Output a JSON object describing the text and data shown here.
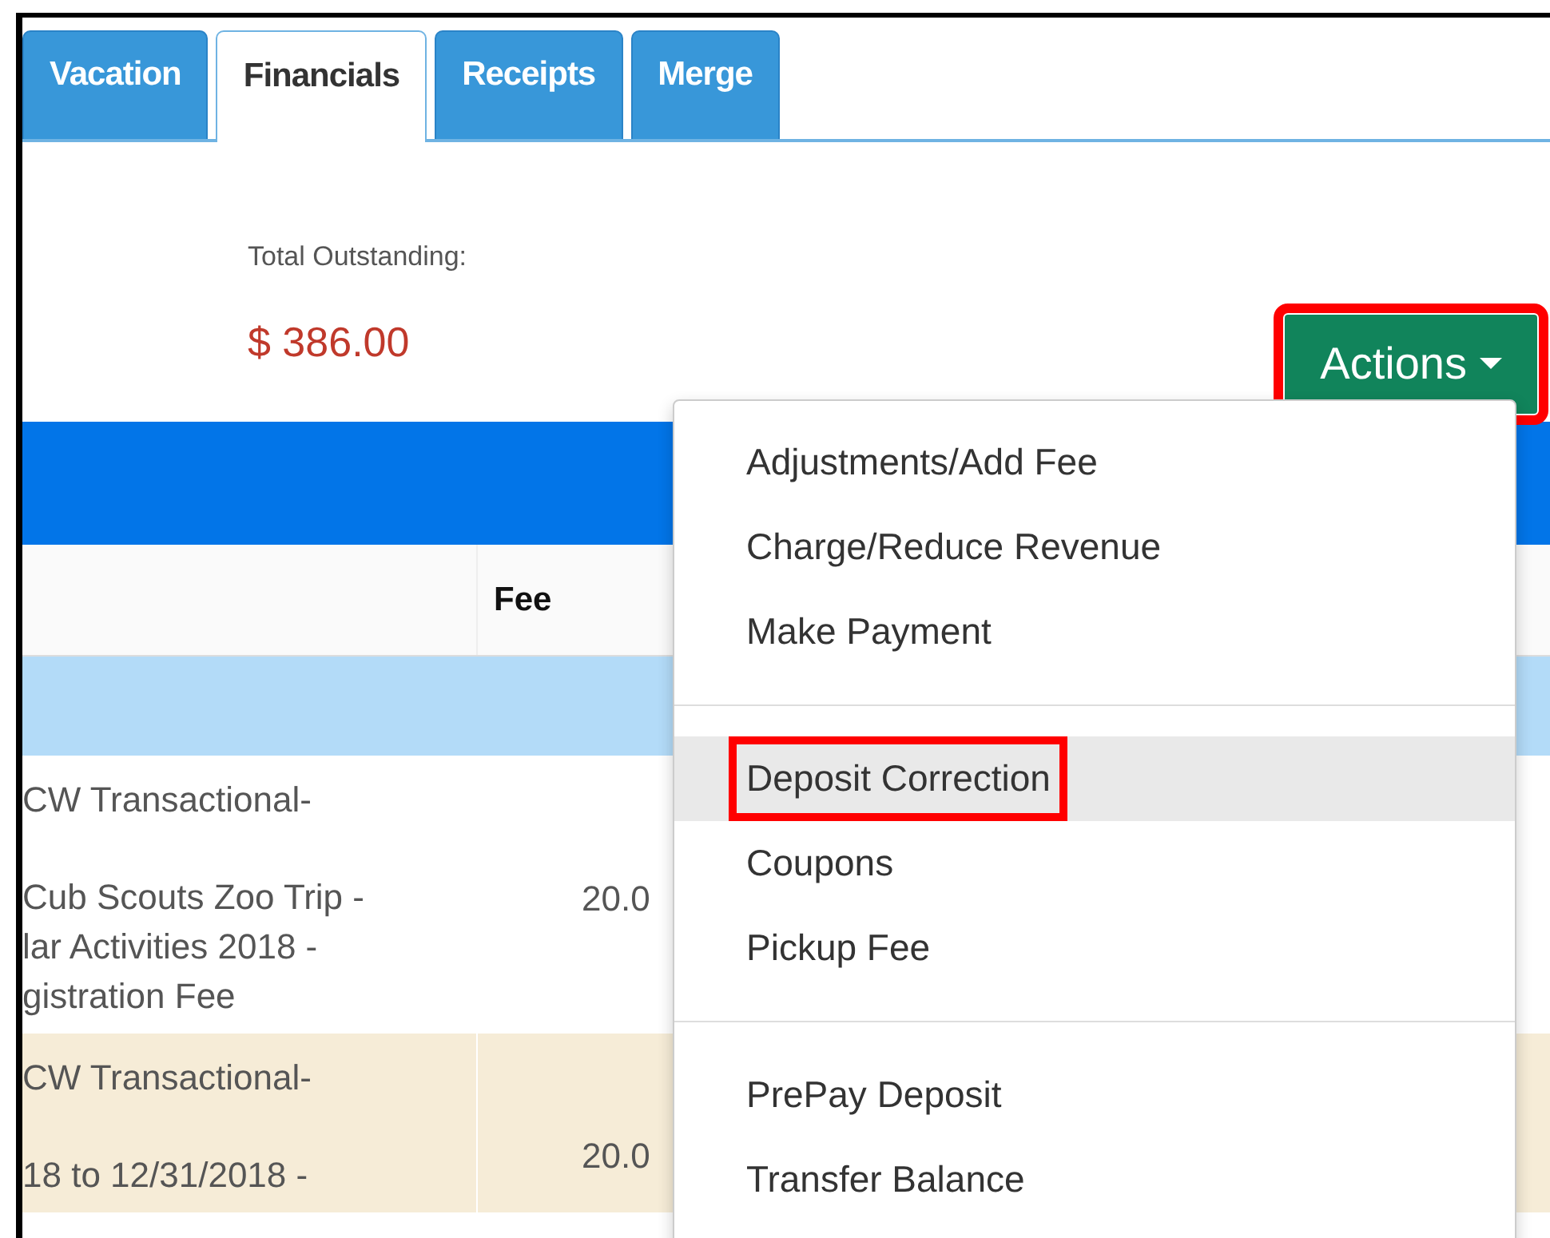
{
  "tabs": [
    {
      "label": "Vacation",
      "selected": false
    },
    {
      "label": "Financials",
      "selected": true
    },
    {
      "label": "Receipts",
      "selected": false
    },
    {
      "label": "Merge",
      "selected": false
    }
  ],
  "summary": {
    "label": "Total Outstanding:",
    "amount": "$ 386.00"
  },
  "actions_button": {
    "label": "Actions",
    "highlighted": true
  },
  "table": {
    "fee_heading": "Fee",
    "rows": [
      {
        "kind": "group"
      },
      {
        "kind": "item",
        "shaded": false,
        "title": "CW Transactional-",
        "detail": [
          "Cub Scouts Zoo Trip -",
          "lar Activities 2018 -",
          "gistration Fee"
        ],
        "fee": "20.0"
      },
      {
        "kind": "item",
        "shaded": true,
        "title": "CW Transactional-",
        "detail": [
          "18 to 12/31/2018 -"
        ],
        "fee": "20.0"
      }
    ]
  },
  "menu": {
    "groups": [
      {
        "items": [
          {
            "label": "Adjustments/Add Fee",
            "hovered": false,
            "highlighted": false
          },
          {
            "label": "Charge/Reduce Revenue",
            "hovered": false,
            "highlighted": false
          },
          {
            "label": "Make Payment",
            "hovered": false,
            "highlighted": false
          }
        ]
      },
      {
        "items": [
          {
            "label": "Deposit Correction",
            "hovered": true,
            "highlighted": true
          },
          {
            "label": "Coupons",
            "hovered": false,
            "highlighted": false
          },
          {
            "label": "Pickup Fee",
            "hovered": false,
            "highlighted": false
          }
        ]
      },
      {
        "items": [
          {
            "label": "PrePay Deposit",
            "hovered": false,
            "highlighted": false
          },
          {
            "label": "Transfer Balance",
            "hovered": false,
            "highlighted": false
          }
        ]
      }
    ]
  }
}
